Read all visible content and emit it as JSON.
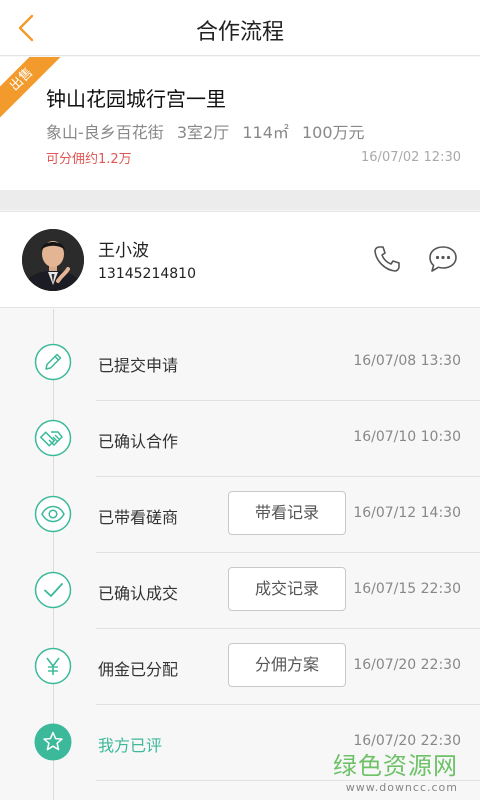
{
  "header": {
    "title": "合作流程"
  },
  "listing": {
    "badge": "出售",
    "name": "钟山花园城行宫一里",
    "location": "象山-良乡百花街",
    "layout": "3室2厅",
    "area": "114㎡",
    "price": "100万元",
    "commission": "可分佣约1.2万",
    "date": "16/07/02 12:30"
  },
  "agent": {
    "name": "王小波",
    "phone": "13145214810"
  },
  "steps": [
    {
      "label": "已提交申请",
      "date": "16/07/08 13:30",
      "icon": "pencil-icon"
    },
    {
      "label": "已确认合作",
      "date": "16/07/10 10:30",
      "icon": "handshake-icon"
    },
    {
      "label": "已带看磋商",
      "date": "16/07/12 14:30",
      "icon": "eye-icon",
      "button": "带看记录"
    },
    {
      "label": "已确认成交",
      "date": "16/07/15 22:30",
      "icon": "check-icon",
      "button": "成交记录"
    },
    {
      "label": "佣金已分配",
      "date": "16/07/20 22:30",
      "icon": "yen-icon",
      "button": "分佣方案"
    },
    {
      "label": "我方已评",
      "date": "16/07/20 22:30",
      "icon": "star-icon"
    }
  ],
  "watermark": {
    "main": "绿色资源网",
    "sub": "www.downcc.com"
  },
  "colors": {
    "accent": "#3cb89a",
    "badge": "#f39a2c",
    "commission": "#e25656",
    "back": "#f39a2c"
  }
}
